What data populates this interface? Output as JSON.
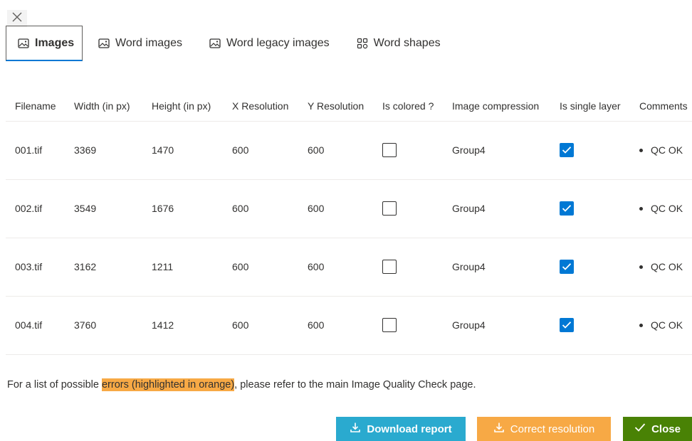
{
  "tabs": [
    {
      "label": "Images",
      "icon": "image-icon",
      "active": true
    },
    {
      "label": "Word images",
      "icon": "image-icon"
    },
    {
      "label": "Word legacy images",
      "icon": "image-icon"
    },
    {
      "label": "Word shapes",
      "icon": "shapes-icon"
    }
  ],
  "table": {
    "headers": [
      "Filename",
      "Width (in px)",
      "Height (in px)",
      "X Resolution",
      "Y Resolution",
      "Is colored ?",
      "Image compression",
      "Is single layer",
      "Comments"
    ],
    "rows": [
      {
        "filename": "001.tif",
        "width": "3369",
        "height": "1470",
        "xres": "600",
        "yres": "600",
        "colored": false,
        "compression": "Group4",
        "single_layer": true,
        "comment": "QC OK"
      },
      {
        "filename": "002.tif",
        "width": "3549",
        "height": "1676",
        "xres": "600",
        "yres": "600",
        "colored": false,
        "compression": "Group4",
        "single_layer": true,
        "comment": "QC OK"
      },
      {
        "filename": "003.tif",
        "width": "3162",
        "height": "1211",
        "xres": "600",
        "yres": "600",
        "colored": false,
        "compression": "Group4",
        "single_layer": true,
        "comment": "QC OK"
      },
      {
        "filename": "004.tif",
        "width": "3760",
        "height": "1412",
        "xres": "600",
        "yres": "600",
        "colored": false,
        "compression": "Group4",
        "single_layer": true,
        "comment": "QC OK"
      }
    ]
  },
  "note": {
    "before": "For a list of possible ",
    "highlight": "errors (highlighted in orange)",
    "after": ", please refer to the main Image Quality Check page."
  },
  "buttons": {
    "download": "Download report",
    "correct": "Correct resolution",
    "close": "Close"
  },
  "colors": {
    "accent": "#0078d4",
    "download": "#2aaacf",
    "correct": "#f7a945",
    "close": "#498205",
    "highlight": "#f7a945"
  }
}
